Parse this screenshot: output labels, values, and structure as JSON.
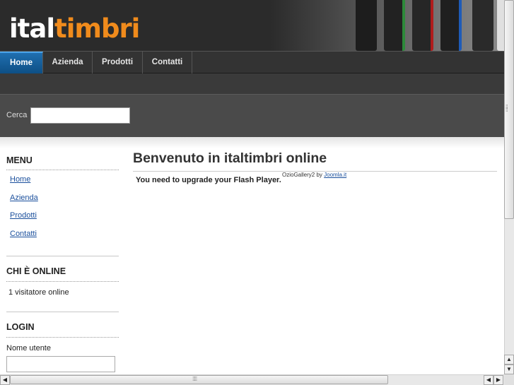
{
  "logo": {
    "part1": "ital",
    "part2": "timbri"
  },
  "nav": {
    "items": [
      {
        "label": "Home",
        "active": true
      },
      {
        "label": "Azienda"
      },
      {
        "label": "Prodotti"
      },
      {
        "label": "Contatti"
      }
    ]
  },
  "search": {
    "label": "Cerca",
    "value": ""
  },
  "sidebar": {
    "menu": {
      "title": "MENU",
      "items": [
        {
          "label": "Home"
        },
        {
          "label": "Azienda"
        },
        {
          "label": "Prodotti"
        },
        {
          "label": "Contatti"
        }
      ]
    },
    "online": {
      "title": "CHI È ONLINE",
      "text": "1 visitatore online"
    },
    "login": {
      "title": "LOGIN",
      "username_label": "Nome utente",
      "username_value": ""
    }
  },
  "main": {
    "title": "Benvenuto in italtimbri online",
    "flash_message": "You need to upgrade your Flash Player.",
    "credit_text": "OzioGallery2 by",
    "credit_link": "Joomla.it"
  },
  "colors": {
    "brand_orange": "#f08b1c",
    "nav_active": "#0e4f85",
    "link": "#1a4f9c"
  },
  "icons": [
    "arrow-up-icon",
    "arrow-down-icon",
    "arrow-left-icon",
    "arrow-right-icon"
  ]
}
